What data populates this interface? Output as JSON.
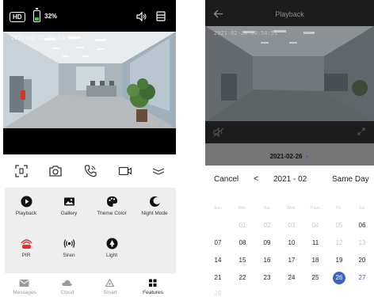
{
  "live": {
    "hd_badge": "HD",
    "battery_text": "32%",
    "battery_level": 0.32,
    "timestamp": "2021-02-21 10:14:16",
    "features": [
      {
        "label": "Playback",
        "icon": "play-icon"
      },
      {
        "label": "Gallery",
        "icon": "gallery-icon"
      },
      {
        "label": "Theme Color",
        "icon": "palette-icon"
      },
      {
        "label": "Night Mode",
        "icon": "moon-icon"
      },
      {
        "label": "PIR",
        "icon": "pir-icon"
      },
      {
        "label": "Siren",
        "icon": "siren-icon"
      },
      {
        "label": "Light",
        "icon": "light-icon"
      }
    ],
    "tabs": [
      {
        "label": "Messages",
        "icon": "mail-icon"
      },
      {
        "label": "Cloud",
        "icon": "cloud-icon"
      },
      {
        "label": "Smart",
        "icon": "recycle-icon"
      },
      {
        "label": "Features",
        "icon": "grid-icon"
      }
    ],
    "active_tab": "Features"
  },
  "playback": {
    "title": "Playback",
    "timestamp": "2021-02-26 08:58:53",
    "selected_date": "2021-02-26",
    "date_arrow": "▼",
    "calendar": {
      "cancel": "Cancel",
      "prev": "<",
      "month": "2021 - 02",
      "same_day": "Same Day",
      "weekdays": [
        "Sun.",
        "Mon.",
        "Tue.",
        "Wed.",
        "Thurs.",
        "Fri.",
        "Sat."
      ],
      "week1": [
        "01",
        "02",
        "03",
        "04",
        "05",
        "06"
      ],
      "week2": [
        "07",
        "08",
        "09",
        "10",
        "11",
        "12",
        "13"
      ],
      "week3": [
        "14",
        "15",
        "16",
        "17",
        "18",
        "19",
        "20"
      ],
      "week4": [
        "21",
        "22",
        "23",
        "24",
        "25",
        "26",
        "27"
      ],
      "week5": [
        "28"
      ]
    },
    "accent": "#3a63c4"
  }
}
